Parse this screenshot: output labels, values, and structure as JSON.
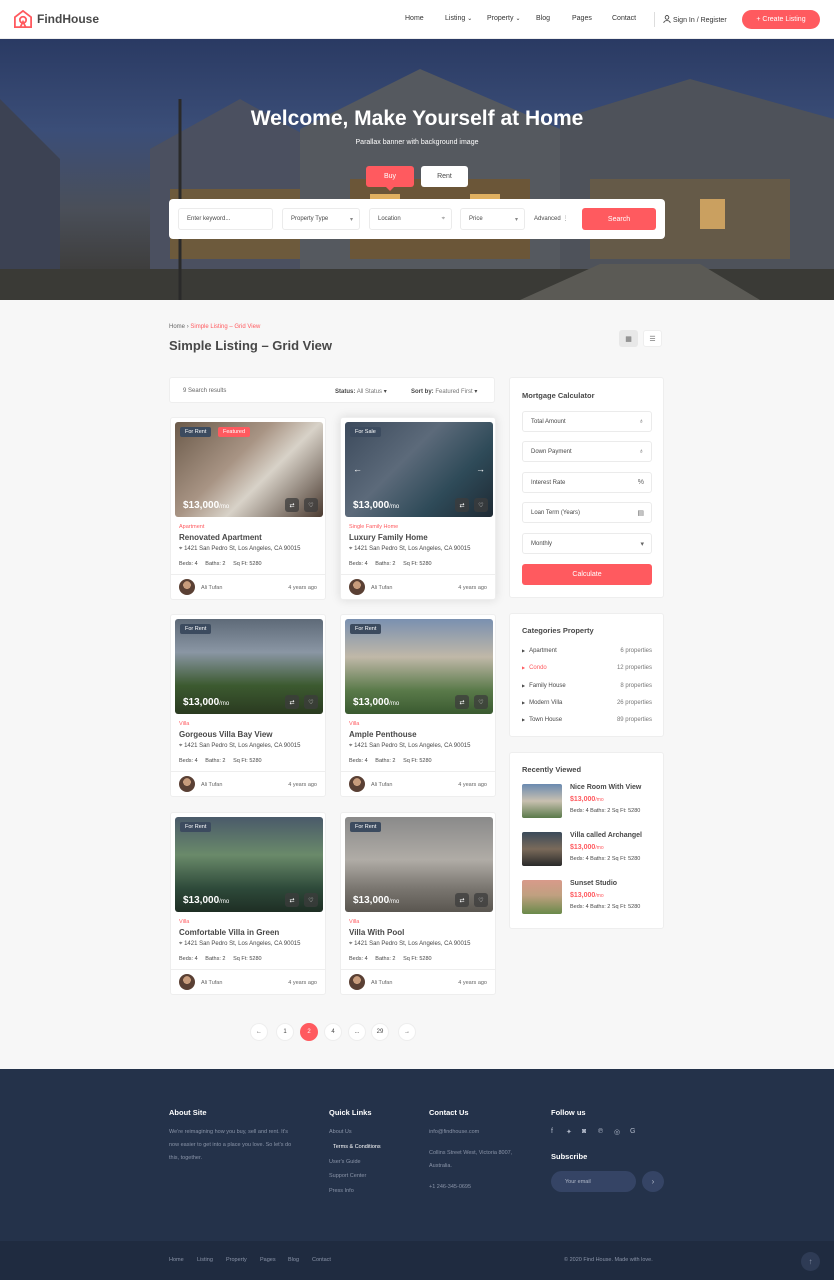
{
  "header": {
    "logo_text": "FindHouse",
    "nav": [
      {
        "label": "Home",
        "chevron": false
      },
      {
        "label": "Listing",
        "chevron": true
      },
      {
        "label": "Property",
        "chevron": true
      },
      {
        "label": "Blog",
        "chevron": false
      },
      {
        "label": "Pages",
        "chevron": false
      },
      {
        "label": "Contact",
        "chevron": false
      }
    ],
    "signin_label": "Sign In / Register",
    "create_label": "+ Create Listing"
  },
  "hero": {
    "title": "Welcome, Make Yourself at Home",
    "subtitle": "Parallax banner with background image",
    "tab_buy": "Buy",
    "tab_rent": "Rent",
    "keyword_placeholder": "Enter keyword...",
    "property_type": "Property Type",
    "location": "Location",
    "price": "Price",
    "advanced": "Advanced",
    "search_label": "Search"
  },
  "main": {
    "breadcrumb_home": "Home",
    "breadcrumb_current": "Simple Listing – Grid View",
    "page_title": "Simple Listing – Grid View",
    "results": "9 Search results",
    "status_label": "Status:",
    "status_value": "All Status",
    "sort_label": "Sort by:",
    "sort_value": "Featured First"
  },
  "listings": [
    {
      "badge": "For Rent",
      "featured": "Featured",
      "price": "$13,000",
      "per": "/mo",
      "type": "Apartment",
      "title": "Renovated Apartment",
      "address": "1421 San Pedro St, Los Angeles, CA 90015",
      "beds": "Beds: 4",
      "baths": "Baths: 2",
      "sqft": "Sq Ft: 5280",
      "agent": "Ali Tufan",
      "ago": "4 years ago"
    },
    {
      "badge": "For Sale",
      "featured": "",
      "price": "$13,000",
      "per": "/mo",
      "type": "Single Family Home",
      "title": "Luxury Family Home",
      "address": "1421 San Pedro St, Los Angeles, CA 90015",
      "beds": "Beds: 4",
      "baths": "Baths: 2",
      "sqft": "Sq Ft: 5280",
      "agent": "Ali Tufan",
      "ago": "4 years ago"
    },
    {
      "badge": "For Rent",
      "featured": "",
      "price": "$13,000",
      "per": "/mo",
      "type": "Villa",
      "title": "Gorgeous Villa Bay View",
      "address": "1421 San Pedro St, Los Angeles, CA 90015",
      "beds": "Beds: 4",
      "baths": "Baths: 2",
      "sqft": "Sq Ft: 5280",
      "agent": "Ali Tufan",
      "ago": "4 years ago"
    },
    {
      "badge": "For Rent",
      "featured": "",
      "price": "$13,000",
      "per": "/mo",
      "type": "Villa",
      "title": "Ample Penthouse",
      "address": "1421 San Pedro St, Los Angeles, CA 90015",
      "beds": "Beds: 4",
      "baths": "Baths: 2",
      "sqft": "Sq Ft: 5280",
      "agent": "Ali Tufan",
      "ago": "4 years ago"
    },
    {
      "badge": "For Rent",
      "featured": "",
      "price": "$13,000",
      "per": "/mo",
      "type": "Villa",
      "title": "Comfortable Villa in Green",
      "address": "1421 San Pedro St, Los Angeles, CA 90015",
      "beds": "Beds: 4",
      "baths": "Baths: 2",
      "sqft": "Sq Ft: 5280",
      "agent": "Ali Tufan",
      "ago": "4 years ago"
    },
    {
      "badge": "For Rent",
      "featured": "",
      "price": "$13,000",
      "per": "/mo",
      "type": "Villa",
      "title": "Villa With Pool",
      "address": "1421 San Pedro St, Los Angeles, CA 90015",
      "beds": "Beds: 4",
      "baths": "Baths: 2",
      "sqft": "Sq Ft: 5280",
      "agent": "Ali Tufan",
      "ago": "4 years ago"
    }
  ],
  "pagination": [
    "←",
    "1",
    "2",
    "4",
    "...",
    "29",
    "→"
  ],
  "pagination_active": "2",
  "mortgage": {
    "title": "Mortgage Calculator",
    "total_amount": "Total Amount",
    "down_payment": "Down Payment",
    "interest_rate": "Interest Rate",
    "loan_term": "Loan Term (Years)",
    "frequency": "Monthly",
    "calculate": "Calculate"
  },
  "categories": {
    "title": "Categories Property",
    "items": [
      {
        "name": "Apartment",
        "count": "6 properties",
        "active": false
      },
      {
        "name": "Condo",
        "count": "12 properties",
        "active": true
      },
      {
        "name": "Family House",
        "count": "8 properties",
        "active": false
      },
      {
        "name": "Modern Villa",
        "count": "26 properties",
        "active": false
      },
      {
        "name": "Town House",
        "count": "89 properties",
        "active": false
      }
    ]
  },
  "recent": {
    "title": "Recently Viewed",
    "items": [
      {
        "title": "Nice Room With View",
        "price": "$13,000",
        "per": "/mo",
        "spec": "Beds: 4   Baths: 2   Sq Ft: 5280"
      },
      {
        "title": "Villa called Archangel",
        "price": "$13,000",
        "per": "/mo",
        "spec": "Beds: 4   Baths: 2   Sq Ft: 5280"
      },
      {
        "title": "Sunset Studio",
        "price": "$13,000",
        "per": "/mo",
        "spec": "Beds: 4   Baths: 2   Sq Ft: 5280"
      }
    ]
  },
  "footer": {
    "about_title": "About Site",
    "about_text": "We're reimagining how you buy, sell and rent. It's now easier to get into a place you love. So let's do this, together.",
    "quick_title": "Quick Links",
    "quick_links": [
      "About Us",
      "Terms & Conditions",
      "User's Guide",
      "Support Center",
      "Press Info"
    ],
    "contact_title": "Contact Us",
    "contact_email": "info@findhouse.com",
    "contact_address": "Collins Street West, Victoria 8007, Australia.",
    "contact_phone": "+1 246-345-0695",
    "follow_title": "Follow us",
    "social_icons": [
      "facebook-icon",
      "twitter-icon",
      "instagram-icon",
      "pinterest-icon",
      "dribbble-icon",
      "google-icon"
    ],
    "subscribe_title": "Subscribe",
    "email_placeholder": "Your email",
    "bottom_links": [
      "Home",
      "Listing",
      "Property",
      "Pages",
      "Blog",
      "Contact"
    ],
    "copyright": "© 2020 Find House. Made with love."
  },
  "colors": {
    "accent": "#ff5a5f",
    "footer": "#24324a",
    "text": "#484848"
  }
}
